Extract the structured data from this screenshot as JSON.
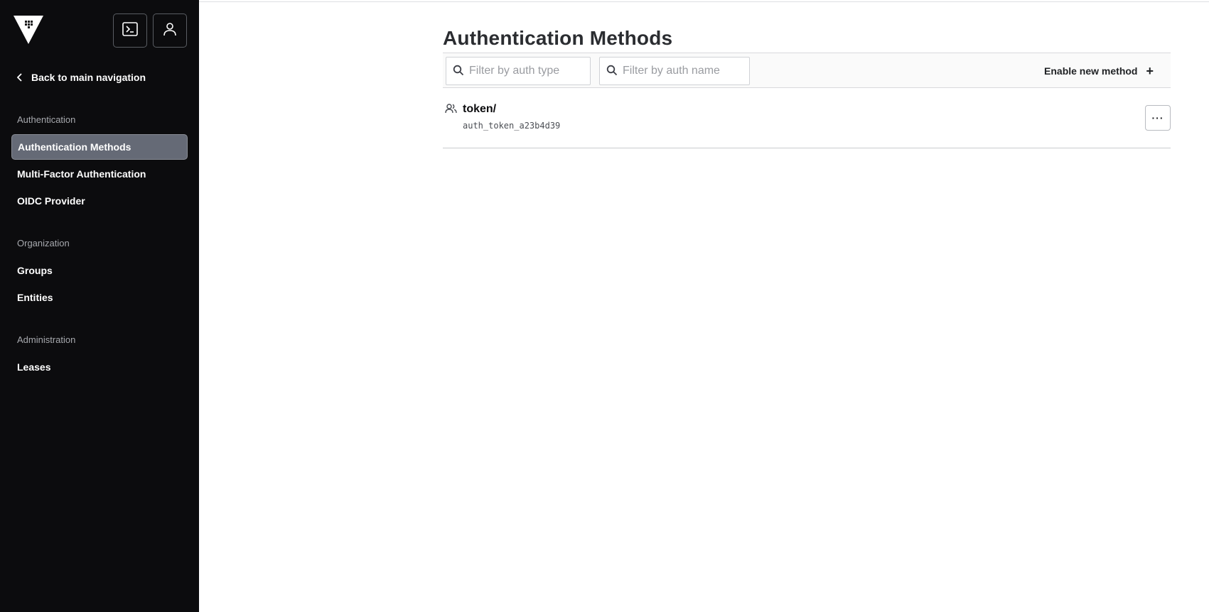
{
  "sidebar": {
    "back_label": "Back to main navigation",
    "sections": [
      {
        "title": "Authentication",
        "items": [
          "Authentication Methods",
          "Multi-Factor Authentication",
          "OIDC Provider"
        ]
      },
      {
        "title": "Organization",
        "items": [
          "Groups",
          "Entities"
        ]
      },
      {
        "title": "Administration",
        "items": [
          "Leases"
        ]
      }
    ],
    "active_item": "Authentication Methods"
  },
  "main": {
    "title": "Authentication Methods",
    "filters": {
      "auth_type_placeholder": "Filter by auth type",
      "auth_name_placeholder": "Filter by auth name"
    },
    "enable_label": "Enable new method",
    "methods": [
      {
        "path": "token/",
        "accessor": "auth_token_a23b4d39",
        "icon": "users-icon"
      }
    ],
    "more_label": "···"
  },
  "colors": {
    "sidebar_bg": "#0c0c0e",
    "active_item_bg": "#656a76",
    "section_title": "#a7a9ae"
  }
}
